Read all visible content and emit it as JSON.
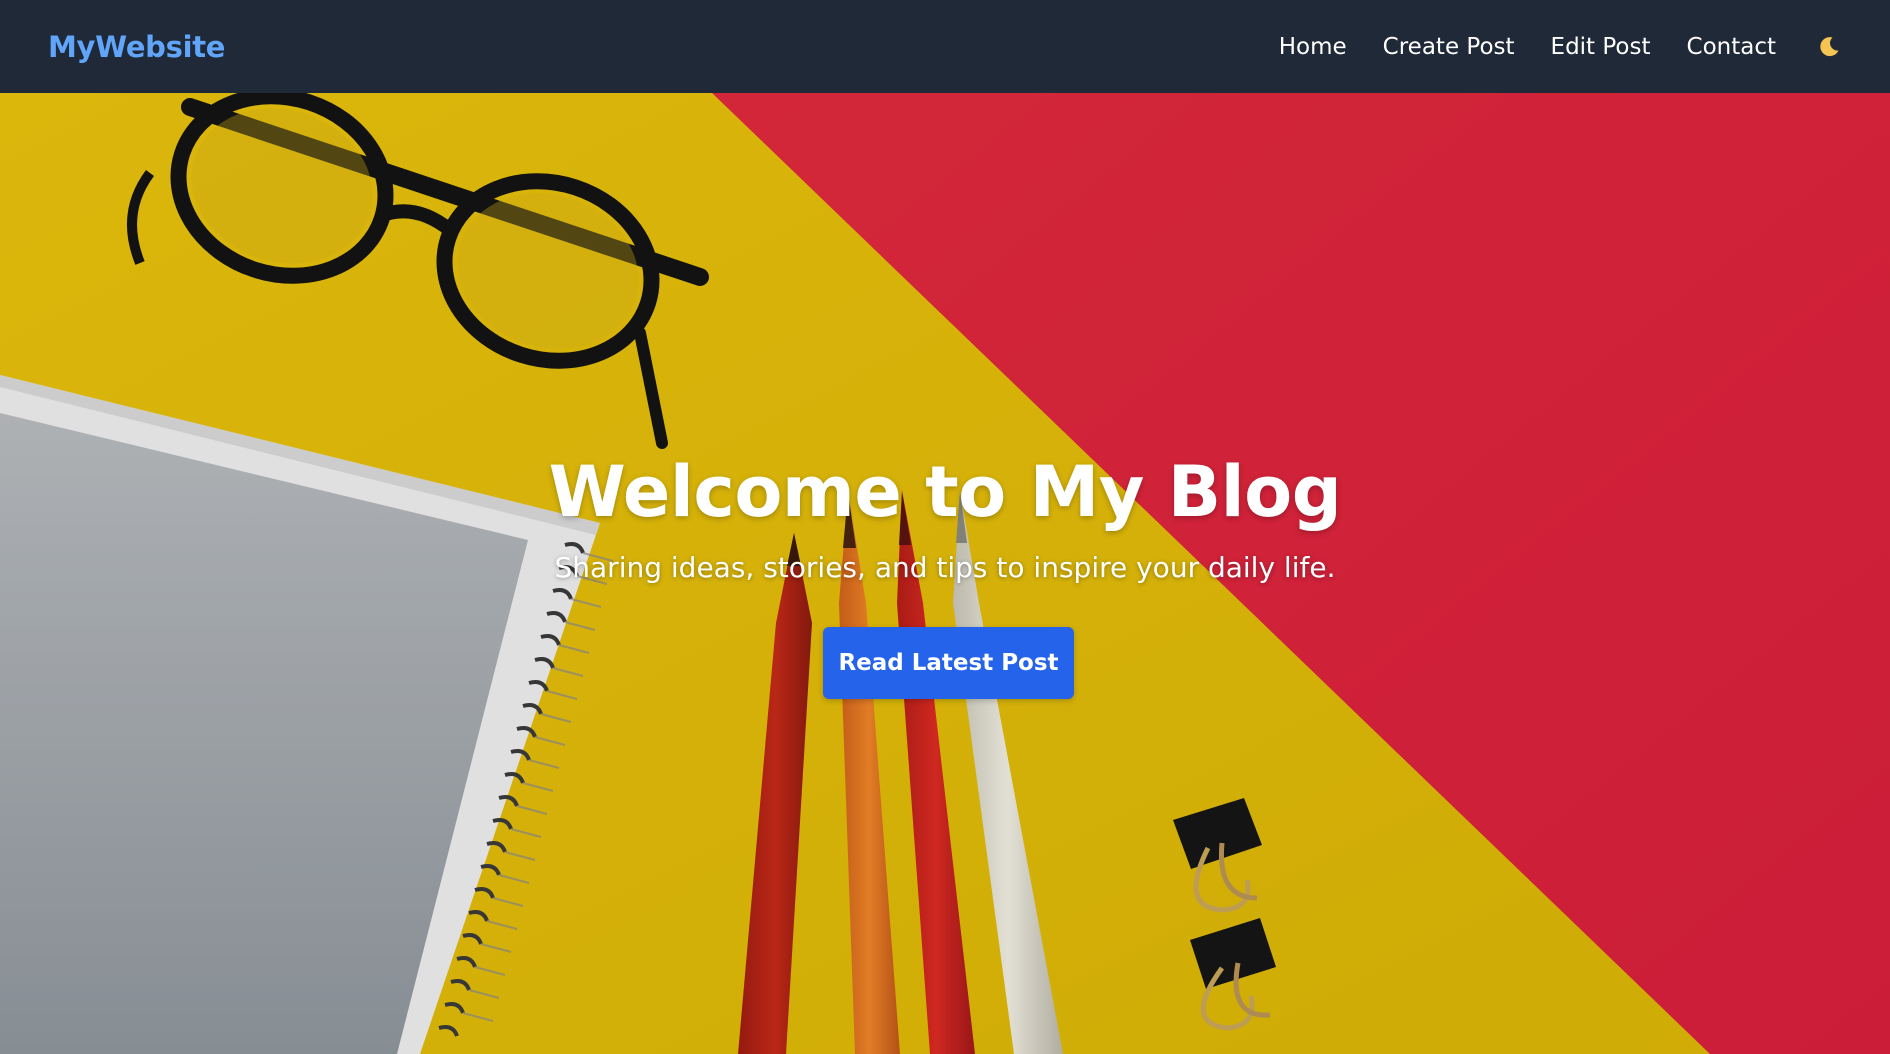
{
  "navbar": {
    "brand": "MyWebsite",
    "links": [
      "Home",
      "Create Post",
      "Edit Post",
      "Contact"
    ],
    "theme_icon": "moon-icon"
  },
  "hero": {
    "title": "Welcome to My Blog",
    "subtitle": "Sharing ideas, stories, and tips to inspire your daily life.",
    "button_label": "Read Latest Post",
    "background_image": "flat-lay-desk-photo"
  },
  "colors": {
    "navbar_bg": "#1f2937",
    "brand": "#60a5fa",
    "button": "#2563eb",
    "hero_yellow": "#e7c10b",
    "hero_red": "#dc2440"
  }
}
